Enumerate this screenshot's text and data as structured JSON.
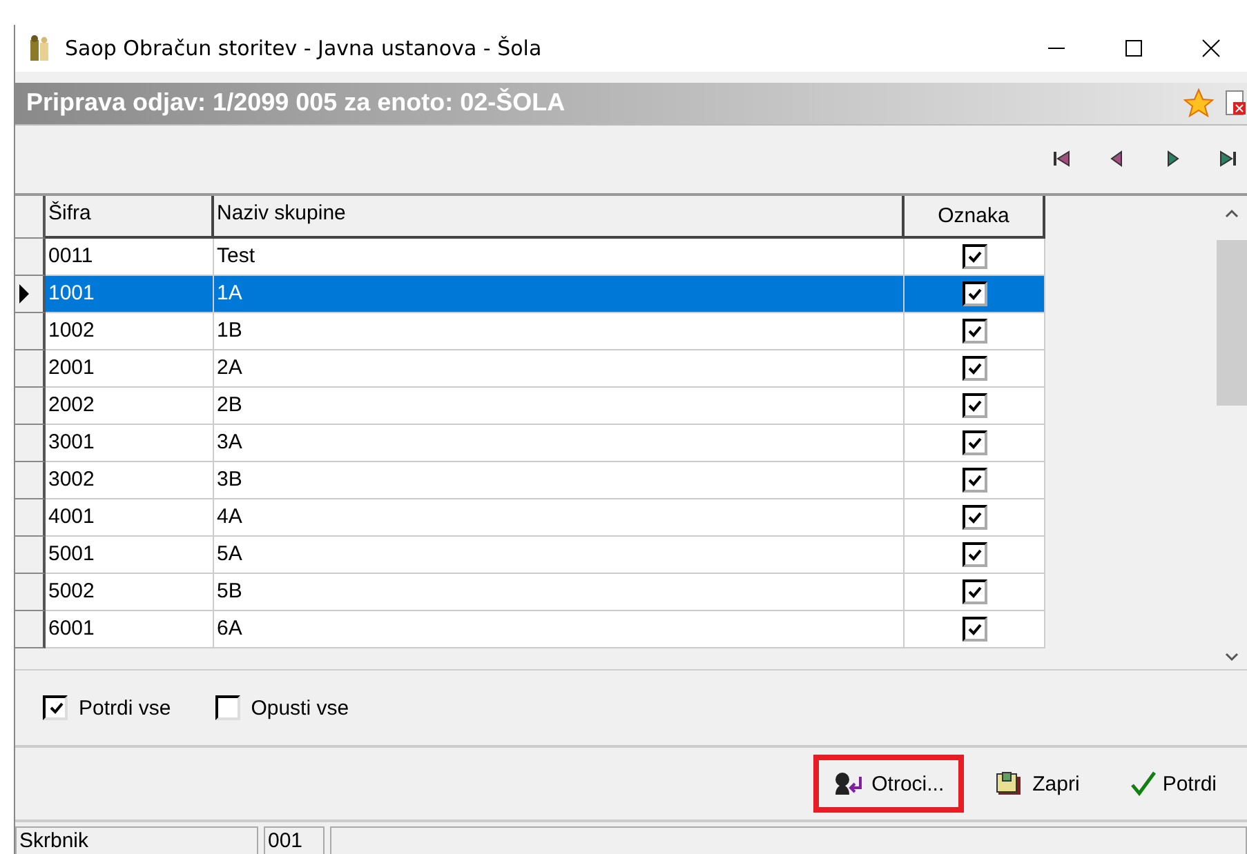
{
  "window": {
    "title": "Saop Obračun storitev - Javna ustanova - Šola"
  },
  "header": {
    "title": "Priprava odjav: 1/2099 005 za enoto: 02-ŠOLA"
  },
  "table": {
    "columns": [
      "Šifra",
      "Naziv skupine",
      "Oznaka"
    ],
    "rows": [
      {
        "code": "0011",
        "name": "Test",
        "checked": true,
        "selected": false
      },
      {
        "code": "1001",
        "name": "1A",
        "checked": true,
        "selected": true
      },
      {
        "code": "1002",
        "name": "1B",
        "checked": true,
        "selected": false
      },
      {
        "code": "2001",
        "name": "2A",
        "checked": true,
        "selected": false
      },
      {
        "code": "2002",
        "name": "2B",
        "checked": true,
        "selected": false
      },
      {
        "code": "3001",
        "name": "3A",
        "checked": true,
        "selected": false
      },
      {
        "code": "3002",
        "name": "3B",
        "checked": true,
        "selected": false
      },
      {
        "code": "4001",
        "name": "4A",
        "checked": true,
        "selected": false
      },
      {
        "code": "5001",
        "name": "5A",
        "checked": true,
        "selected": false
      },
      {
        "code": "5002",
        "name": "5B",
        "checked": true,
        "selected": false
      },
      {
        "code": "6001",
        "name": "6A",
        "checked": true,
        "selected": false
      }
    ]
  },
  "options": [
    {
      "label": "Potrdi vse",
      "checked": true
    },
    {
      "label": "Opusti vse",
      "checked": false
    }
  ],
  "buttons": [
    {
      "kind": "children",
      "label": "Otroci...",
      "highlighted": true
    },
    {
      "kind": "close",
      "label": "Zapri",
      "highlighted": false
    },
    {
      "kind": "confirm",
      "label": "Potrdi",
      "highlighted": false
    }
  ],
  "status_bar": [
    "Skrbnik",
    "001"
  ]
}
